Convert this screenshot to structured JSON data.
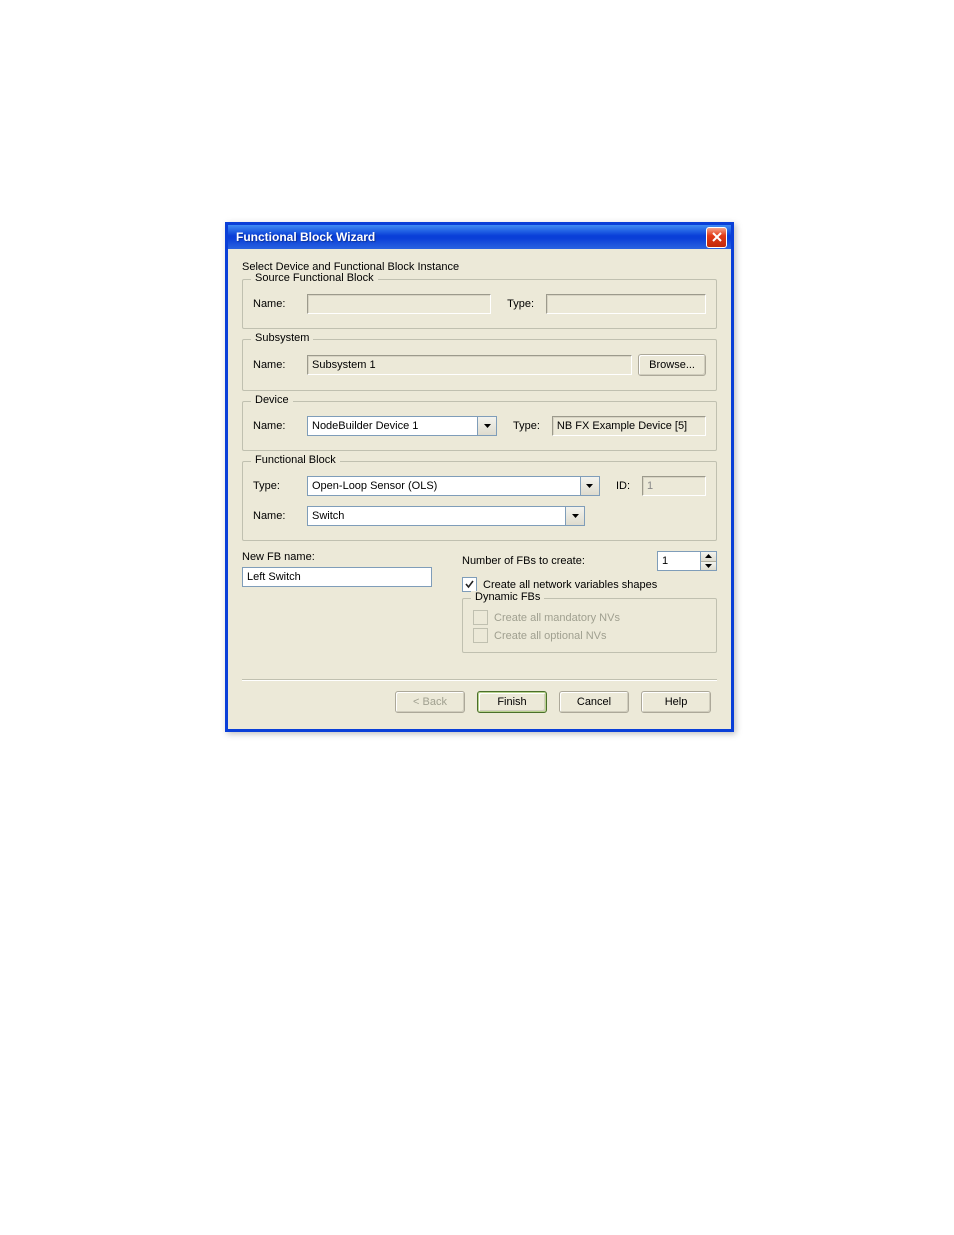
{
  "window": {
    "title": "Functional Block Wizard"
  },
  "instruction": "Select Device and Functional Block Instance",
  "source": {
    "legend": "Source Functional Block",
    "name_label": "Name:",
    "name_value": "",
    "type_label": "Type:",
    "type_value": ""
  },
  "subsystem": {
    "legend": "Subsystem",
    "name_label": "Name:",
    "name_value": "Subsystem 1",
    "browse": "Browse..."
  },
  "device": {
    "legend": "Device",
    "name_label": "Name:",
    "name_value": "NodeBuilder Device 1",
    "type_label": "Type:",
    "type_value": "NB FX Example Device [5]"
  },
  "fb": {
    "legend": "Functional Block",
    "type_label": "Type:",
    "type_value": "Open-Loop Sensor (OLS)",
    "id_label": "ID:",
    "id_value": "1",
    "name_label": "Name:",
    "name_value": "Switch"
  },
  "new_fb": {
    "name_label": "New FB name:",
    "name_value": "Left Switch",
    "count_label": "Number of FBs to create:",
    "count_value": "1",
    "create_nv_shapes": "Create all network variables shapes",
    "dynamic_legend": "Dynamic FBs",
    "create_mandatory": "Create all mandatory NVs",
    "create_optional": "Create all optional NVs"
  },
  "buttons": {
    "back": "< Back",
    "finish": "Finish",
    "cancel": "Cancel",
    "help": "Help"
  }
}
